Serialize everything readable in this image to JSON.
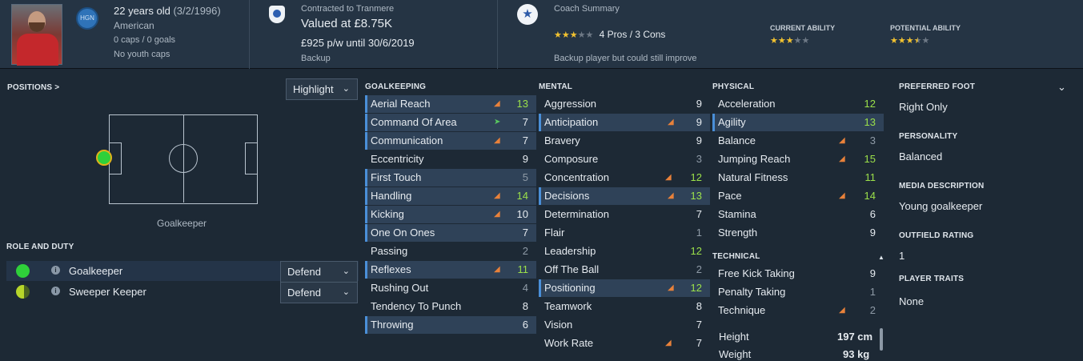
{
  "header": {
    "age": "22 years old",
    "dob": "(3/2/1996)",
    "nation_code": "HGN",
    "nationality": "American",
    "caps": "0 caps / 0 goals",
    "youth": "No youth caps",
    "contract_label": "Contracted to Tranmere",
    "value": "Valued at £8.75K",
    "wage": "£925 p/w until 30/6/2019",
    "squad_status": "Backup",
    "coach_title": "Coach Summary",
    "coach_pros_cons": "4 Pros / 3 Cons",
    "coach_stars": "★★★★★",
    "coach_note": "Backup player but could still improve",
    "ca_label": "CURRENT ABILITY",
    "ca_stars": "★★★★★",
    "pa_label": "POTENTIAL ABILITY",
    "pa_stars": "★★★★★",
    "current_ability_stars": 3,
    "potential_ability_stars": 3.5
  },
  "positions": {
    "title": "POSITIONS",
    "arrow": ">",
    "dropdown": "Highlight",
    "natural_position": "Goalkeeper"
  },
  "roles": {
    "title": "ROLE AND DUTY",
    "items": [
      {
        "name": "Goalkeeper",
        "duty": "Defend",
        "color": "#2fd03a"
      },
      {
        "name": "Sweeper Keeper",
        "duty": "Defend",
        "color": "#b7d62a"
      }
    ]
  },
  "goalkeeping": {
    "title": "GOALKEEPING",
    "attrs": [
      {
        "label": "Aerial Reach",
        "value": "13",
        "hl": true,
        "trend": "up"
      },
      {
        "label": "Command Of Area",
        "value": "7",
        "hl": true,
        "trend": "flat"
      },
      {
        "label": "Communication",
        "value": "7",
        "hl": true,
        "trend": "up"
      },
      {
        "label": "Eccentricity",
        "value": "9",
        "hl": false,
        "trend": ""
      },
      {
        "label": "First Touch",
        "value": "5",
        "hl": true,
        "trend": ""
      },
      {
        "label": "Handling",
        "value": "14",
        "hl": true,
        "trend": "up"
      },
      {
        "label": "Kicking",
        "value": "10",
        "hl": true,
        "trend": "up"
      },
      {
        "label": "One On Ones",
        "value": "7",
        "hl": true,
        "trend": ""
      },
      {
        "label": "Passing",
        "value": "2",
        "hl": false,
        "trend": ""
      },
      {
        "label": "Reflexes",
        "value": "11",
        "hl": true,
        "trend": "up"
      },
      {
        "label": "Rushing Out",
        "value": "4",
        "hl": false,
        "trend": ""
      },
      {
        "label": "Tendency To Punch",
        "value": "8",
        "hl": false,
        "trend": ""
      },
      {
        "label": "Throwing",
        "value": "6",
        "hl": true,
        "trend": ""
      }
    ]
  },
  "mental": {
    "title": "MENTAL",
    "attrs": [
      {
        "label": "Aggression",
        "value": "9",
        "hl": false,
        "trend": ""
      },
      {
        "label": "Anticipation",
        "value": "9",
        "hl": true,
        "trend": "up"
      },
      {
        "label": "Bravery",
        "value": "9",
        "hl": false,
        "trend": ""
      },
      {
        "label": "Composure",
        "value": "3",
        "hl": false,
        "trend": ""
      },
      {
        "label": "Concentration",
        "value": "12",
        "hl": false,
        "trend": "up"
      },
      {
        "label": "Decisions",
        "value": "13",
        "hl": true,
        "trend": "up"
      },
      {
        "label": "Determination",
        "value": "7",
        "hl": false,
        "trend": ""
      },
      {
        "label": "Flair",
        "value": "1",
        "hl": false,
        "trend": ""
      },
      {
        "label": "Leadership",
        "value": "12",
        "hl": false,
        "trend": ""
      },
      {
        "label": "Off The Ball",
        "value": "2",
        "hl": false,
        "trend": ""
      },
      {
        "label": "Positioning",
        "value": "12",
        "hl": true,
        "trend": "up"
      },
      {
        "label": "Teamwork",
        "value": "8",
        "hl": false,
        "trend": ""
      },
      {
        "label": "Vision",
        "value": "7",
        "hl": false,
        "trend": ""
      },
      {
        "label": "Work Rate",
        "value": "7",
        "hl": false,
        "trend": "up"
      }
    ]
  },
  "physical": {
    "title": "PHYSICAL",
    "attrs": [
      {
        "label": "Acceleration",
        "value": "12",
        "hl": false,
        "trend": ""
      },
      {
        "label": "Agility",
        "value": "13",
        "hl": true,
        "trend": ""
      },
      {
        "label": "Balance",
        "value": "3",
        "hl": false,
        "trend": "up"
      },
      {
        "label": "Jumping Reach",
        "value": "15",
        "hl": false,
        "trend": "up"
      },
      {
        "label": "Natural Fitness",
        "value": "11",
        "hl": false,
        "trend": ""
      },
      {
        "label": "Pace",
        "value": "14",
        "hl": false,
        "trend": "up"
      },
      {
        "label": "Stamina",
        "value": "6",
        "hl": false,
        "trend": ""
      },
      {
        "label": "Strength",
        "value": "9",
        "hl": false,
        "trend": ""
      }
    ]
  },
  "technical": {
    "title": "TECHNICAL",
    "attrs": [
      {
        "label": "Free Kick Taking",
        "value": "9",
        "hl": false,
        "trend": ""
      },
      {
        "label": "Penalty Taking",
        "value": "1",
        "hl": false,
        "trend": ""
      },
      {
        "label": "Technique",
        "value": "2",
        "hl": false,
        "trend": "up"
      }
    ]
  },
  "body": {
    "height_label": "Height",
    "height_value": "197 cm",
    "weight_label": "Weight",
    "weight_value": "93 kg"
  },
  "info": {
    "foot_label": "PREFERRED FOOT",
    "foot_value": "Right Only",
    "personality_label": "PERSONALITY",
    "personality_value": "Balanced",
    "media_label": "MEDIA DESCRIPTION",
    "media_value": "Young goalkeeper",
    "outfield_label": "OUTFIELD RATING",
    "outfield_value": "1",
    "traits_label": "PLAYER TRAITS",
    "traits_value": "None"
  },
  "colors": {
    "accent": "#4a8fd8",
    "trend_up": "#e8813a",
    "trend_flat": "#59c95f",
    "value_high": "#9be04a",
    "star_on": "#f2c230"
  }
}
